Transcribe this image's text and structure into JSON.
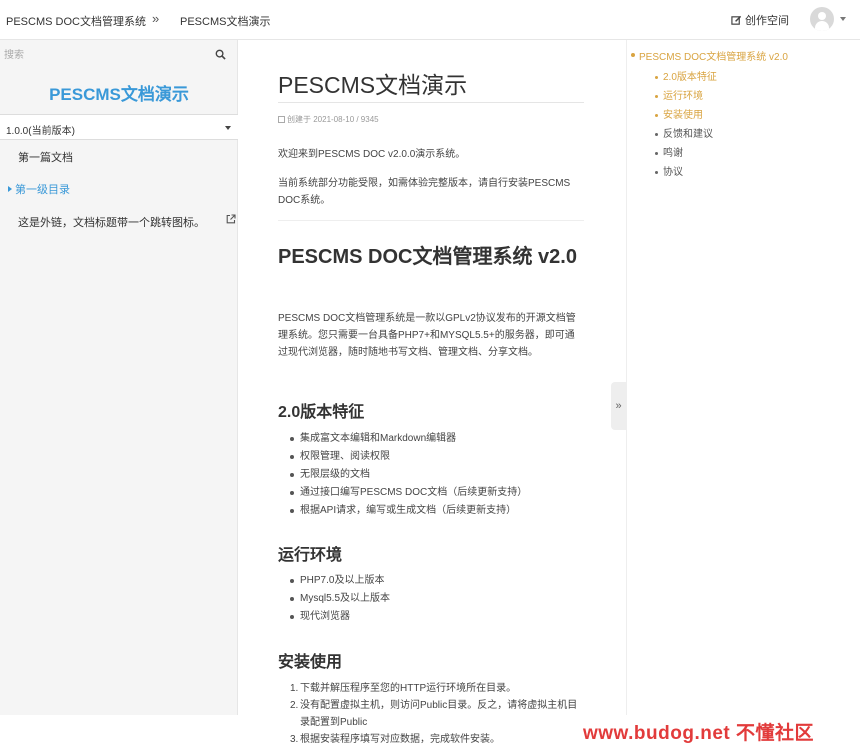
{
  "header": {
    "breadcrumb_root": "PESCMS DOC文档管理系统",
    "breadcrumb_sep": "»",
    "breadcrumb_current": "PESCMS文档演示",
    "creator_label": "创作空间"
  },
  "sidebar": {
    "search_placeholder": "搜索",
    "logo_title": "PESCMS文档演示",
    "version": "1.0.0(当前版本)",
    "items": [
      {
        "label": "第一篇文档"
      },
      {
        "label": "第一级目录"
      },
      {
        "label": "这是外链，文档标题带一个跳转图标。"
      }
    ]
  },
  "article": {
    "title": "PESCMS文档演示",
    "meta": "创建于 2021-08-10 / 9345",
    "intro1": "欢迎来到PESCMS DOC v2.0.0演示系统。",
    "intro2": "当前系统部分功能受限，如需体验完整版本，请自行安装PESCMS DOC系统。",
    "h1": "PESCMS DOC文档管理系统 v2.0",
    "desc": "PESCMS DOC文档管理系统是一款以GPLv2协议发布的开源文档管理系统。您只需要一台具备PHP7+和MYSQL5.5+的服务器，即可通过现代浏览器，随时随地书写文档、管理文档、分享文档。",
    "features_title": "2.0版本特征",
    "features": [
      "集成富文本编辑和Markdown编辑器",
      "权限管理、阅读权限",
      "无限层级的文档",
      "通过接口编写PESCMS DOC文档（后续更新支持）",
      "根据API请求，编写或生成文档（后续更新支持）"
    ],
    "env_title": "运行环境",
    "env": [
      "PHP7.0及以上版本",
      "Mysql5.5及以上版本",
      "现代浏览器"
    ],
    "install_title": "安装使用",
    "install": [
      {
        "num": "1.",
        "text": "下载并解压程序至您的HTTP运行环境所在目录。"
      },
      {
        "num": "2.",
        "text": "没有配置虚拟主机，则访问Public目录。反之，请将虚拟主机目录配置到Public"
      },
      {
        "num": "3.",
        "text": "根据安装程序填写对应数据，完成软件安装。"
      }
    ]
  },
  "toggle_label": "»",
  "toc": {
    "root": "PESCMS DOC文档管理系统 v2.0",
    "items": [
      {
        "label": "2.0版本特征",
        "active": true
      },
      {
        "label": "运行环境",
        "active": true
      },
      {
        "label": "安装使用",
        "active": true
      },
      {
        "label": "反馈和建议",
        "active": false
      },
      {
        "label": "鸣谢",
        "active": false
      },
      {
        "label": "协议",
        "active": false
      }
    ]
  },
  "watermark": "www.budog.net 不懂社区",
  "colors": {
    "accent_blue": "#3a99d8",
    "toc_active": "#d9a441",
    "watermark": "#e23b3b"
  }
}
